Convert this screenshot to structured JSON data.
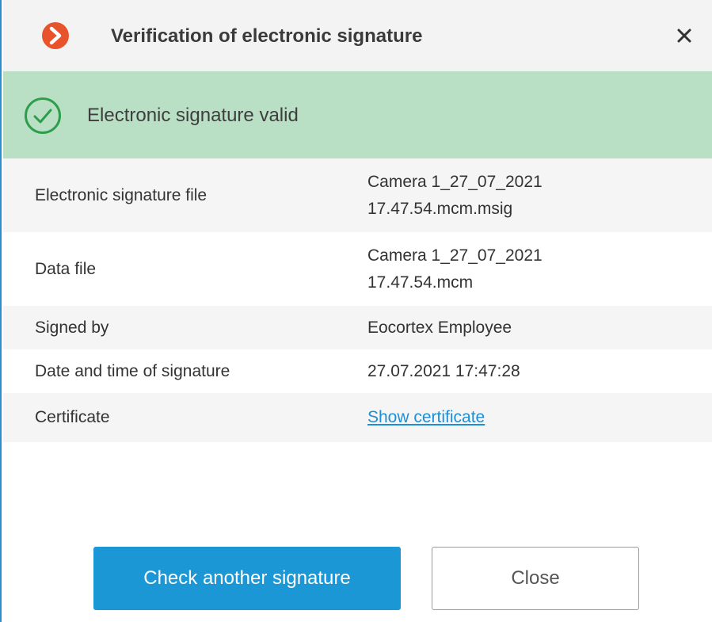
{
  "dialog": {
    "title": "Verification of electronic signature",
    "close_icon": "close-icon",
    "logo_icon": "app-logo-icon",
    "accent_color": "#1b97d6",
    "logo_color": "#e8532c"
  },
  "status": {
    "text": "Electronic signature valid",
    "icon": "check-circle-icon",
    "banner_color": "#b9e0c5",
    "icon_color": "#2e9e4c"
  },
  "details": [
    {
      "label": "Electronic signature file",
      "value_line1": "Camera 1_27_07_2021",
      "value_line2": "17.47.54.mcm.msig"
    },
    {
      "label": "Data file",
      "value_line1": "Camera 1_27_07_2021",
      "value_line2": "17.47.54.mcm"
    },
    {
      "label": "Signed by",
      "value_line1": "Eocortex Employee"
    },
    {
      "label": "Date and time of signature",
      "value_line1": "27.07.2021 17:47:28"
    },
    {
      "label": "Certificate",
      "link_text": "Show certificate"
    }
  ],
  "buttons": {
    "check_another": "Check another signature",
    "close": "Close"
  }
}
